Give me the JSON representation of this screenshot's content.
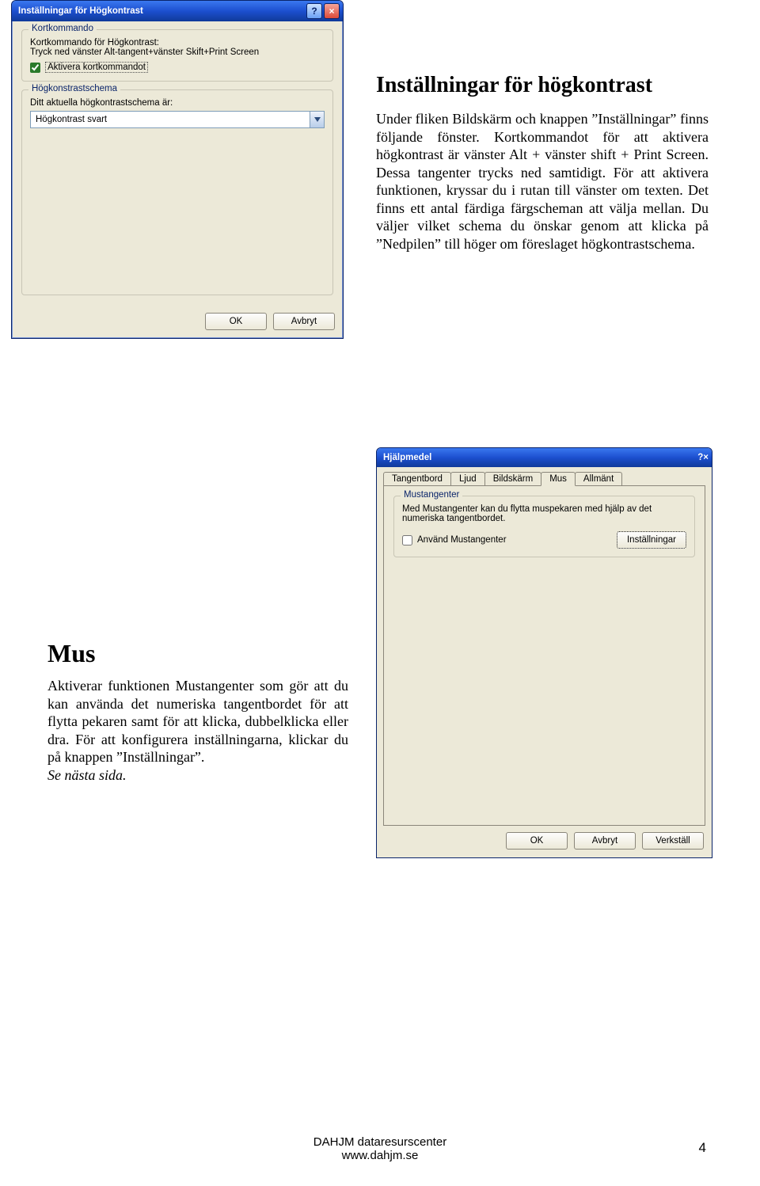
{
  "dialog1": {
    "title": "Inställningar för Högkontrast",
    "help_icon": "?",
    "close_icon": "×",
    "group1_legend": "Kortkommando",
    "shortcut_label_line1": "Kortkommando för Högkontrast:",
    "shortcut_label_line2": "Tryck ned vänster Alt-tangent+vänster Skift+Print Screen",
    "checkbox_label": "Aktivera kortkommandot",
    "group2_legend": "Högkonstrastschema",
    "schema_label": "Ditt aktuella högkontrastschema är:",
    "schema_value": "Högkontrast svart",
    "ok": "OK",
    "cancel": "Avbryt"
  },
  "article1": {
    "heading": "Inställningar för högkontrast",
    "body": "Under fliken Bildskärm och knappen ”Inställningar” finns följande fönster. Kortkommandot för att aktivera högkontrast är vänster Alt + vänster shift + Print Screen. Dessa tangenter trycks ned samtidigt. För att aktivera funktionen, kryssar du i rutan till vänster om texten. Det finns ett antal färdiga färgscheman att välja mellan. Du väljer vilket schema du önskar genom att klicka på ”Nedpilen” till höger om föreslaget högkontrastschema."
  },
  "article2": {
    "heading": "Mus",
    "body": "Aktiverar funktionen Mustangenter som gör att du kan använda det numeriska tangentbordet för att flytta pekaren samt för att klicka, dubbelklicka eller dra. För att konfigurera inställningarna, klickar du på knappen ”Inställningar”.",
    "italic": "Se nästa sida."
  },
  "dialog2": {
    "title": "Hjälpmedel",
    "tabs": [
      "Tangentbord",
      "Ljud",
      "Bildskärm",
      "Mus",
      "Allmänt"
    ],
    "active_tab_index": 3,
    "group_legend": "Mustangenter",
    "group_text": "Med Mustangenter kan du flytta muspekaren med hjälp av det numeriska tangentbordet.",
    "checkbox_label": "Använd Mustangenter",
    "settings_btn": "Inställningar",
    "ok": "OK",
    "cancel": "Avbryt",
    "apply": "Verkställ"
  },
  "footer": {
    "line1": "DAHJM dataresurscenter",
    "line2": "www.dahjm.se",
    "page": "4"
  }
}
